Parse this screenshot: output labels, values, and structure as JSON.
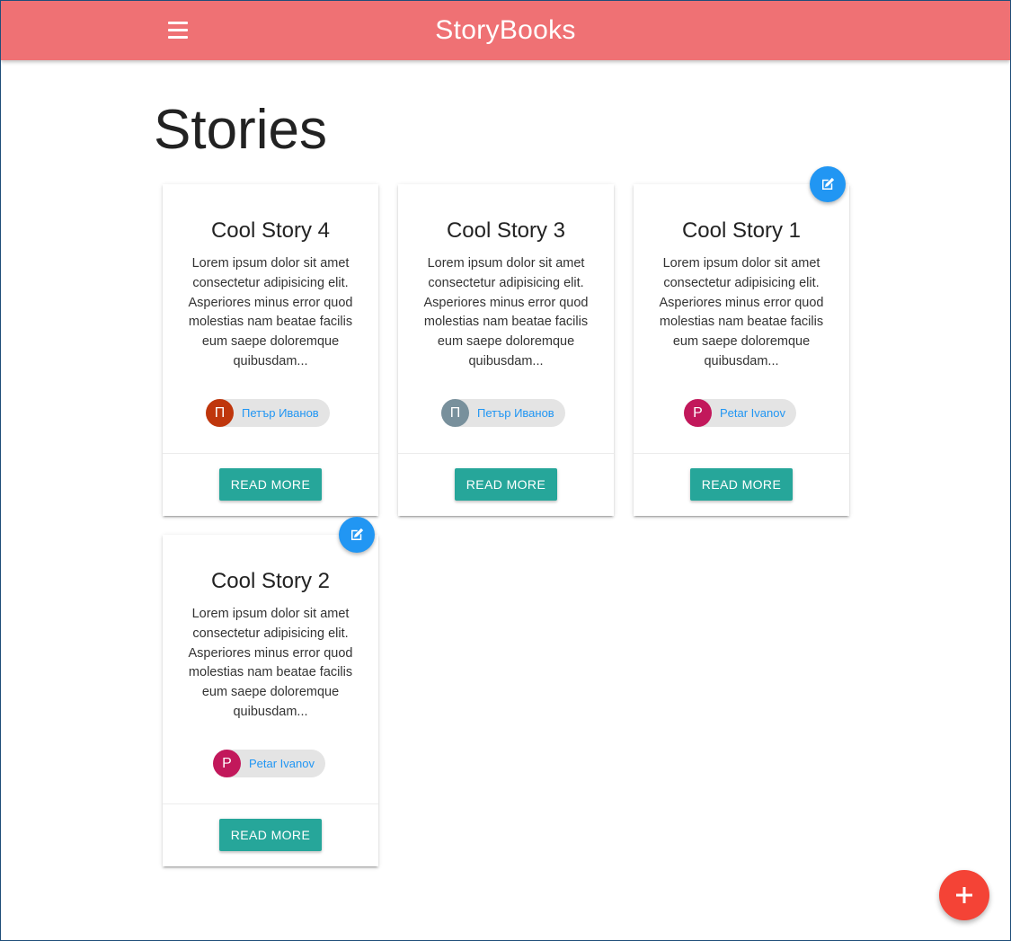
{
  "navbar": {
    "brand": "StoryBooks",
    "menu_icon": "hamburger-menu-icon",
    "color": "#ef7174"
  },
  "page": {
    "title": "Stories"
  },
  "stories": [
    {
      "title": "Cool Story 4",
      "excerpt": "Lorem ipsum dolor sit amet consectetur adipisicing elit. Asperiores minus error quod molestias nam beatae facilis eum saepe doloremque quibusdam...",
      "author": {
        "initial": "П",
        "name": "Петър Иванов",
        "avatar_color": "#bf360c"
      },
      "read_more": "READ MORE",
      "editable": false
    },
    {
      "title": "Cool Story 3",
      "excerpt": "Lorem ipsum dolor sit amet consectetur adipisicing elit. Asperiores minus error quod molestias nam beatae facilis eum saepe doloremque quibusdam...",
      "author": {
        "initial": "П",
        "name": "Петър Иванов",
        "avatar_color": "#78909c"
      },
      "read_more": "READ MORE",
      "editable": false
    },
    {
      "title": "Cool Story 1",
      "excerpt": "Lorem ipsum dolor sit amet consectetur adipisicing elit. Asperiores minus error quod molestias nam beatae facilis eum saepe doloremque quibusdam...",
      "author": {
        "initial": "P",
        "name": "Petar Ivanov",
        "avatar_color": "#c2185b"
      },
      "read_more": "READ MORE",
      "editable": true
    },
    {
      "title": "Cool Story 2",
      "excerpt": "Lorem ipsum dolor sit amet consectetur adipisicing elit. Asperiores minus error quod molestias nam beatae facilis eum saepe doloremque quibusdam...",
      "author": {
        "initial": "P",
        "name": "Petar Ivanov",
        "avatar_color": "#c2185b"
      },
      "read_more": "READ MORE",
      "editable": true
    }
  ],
  "icons": {
    "edit": "edit-pencil-icon",
    "add": "plus-icon"
  },
  "colors": {
    "button": "#26a69a",
    "edit_fab": "#2196f3",
    "add_fab": "#f44336"
  }
}
